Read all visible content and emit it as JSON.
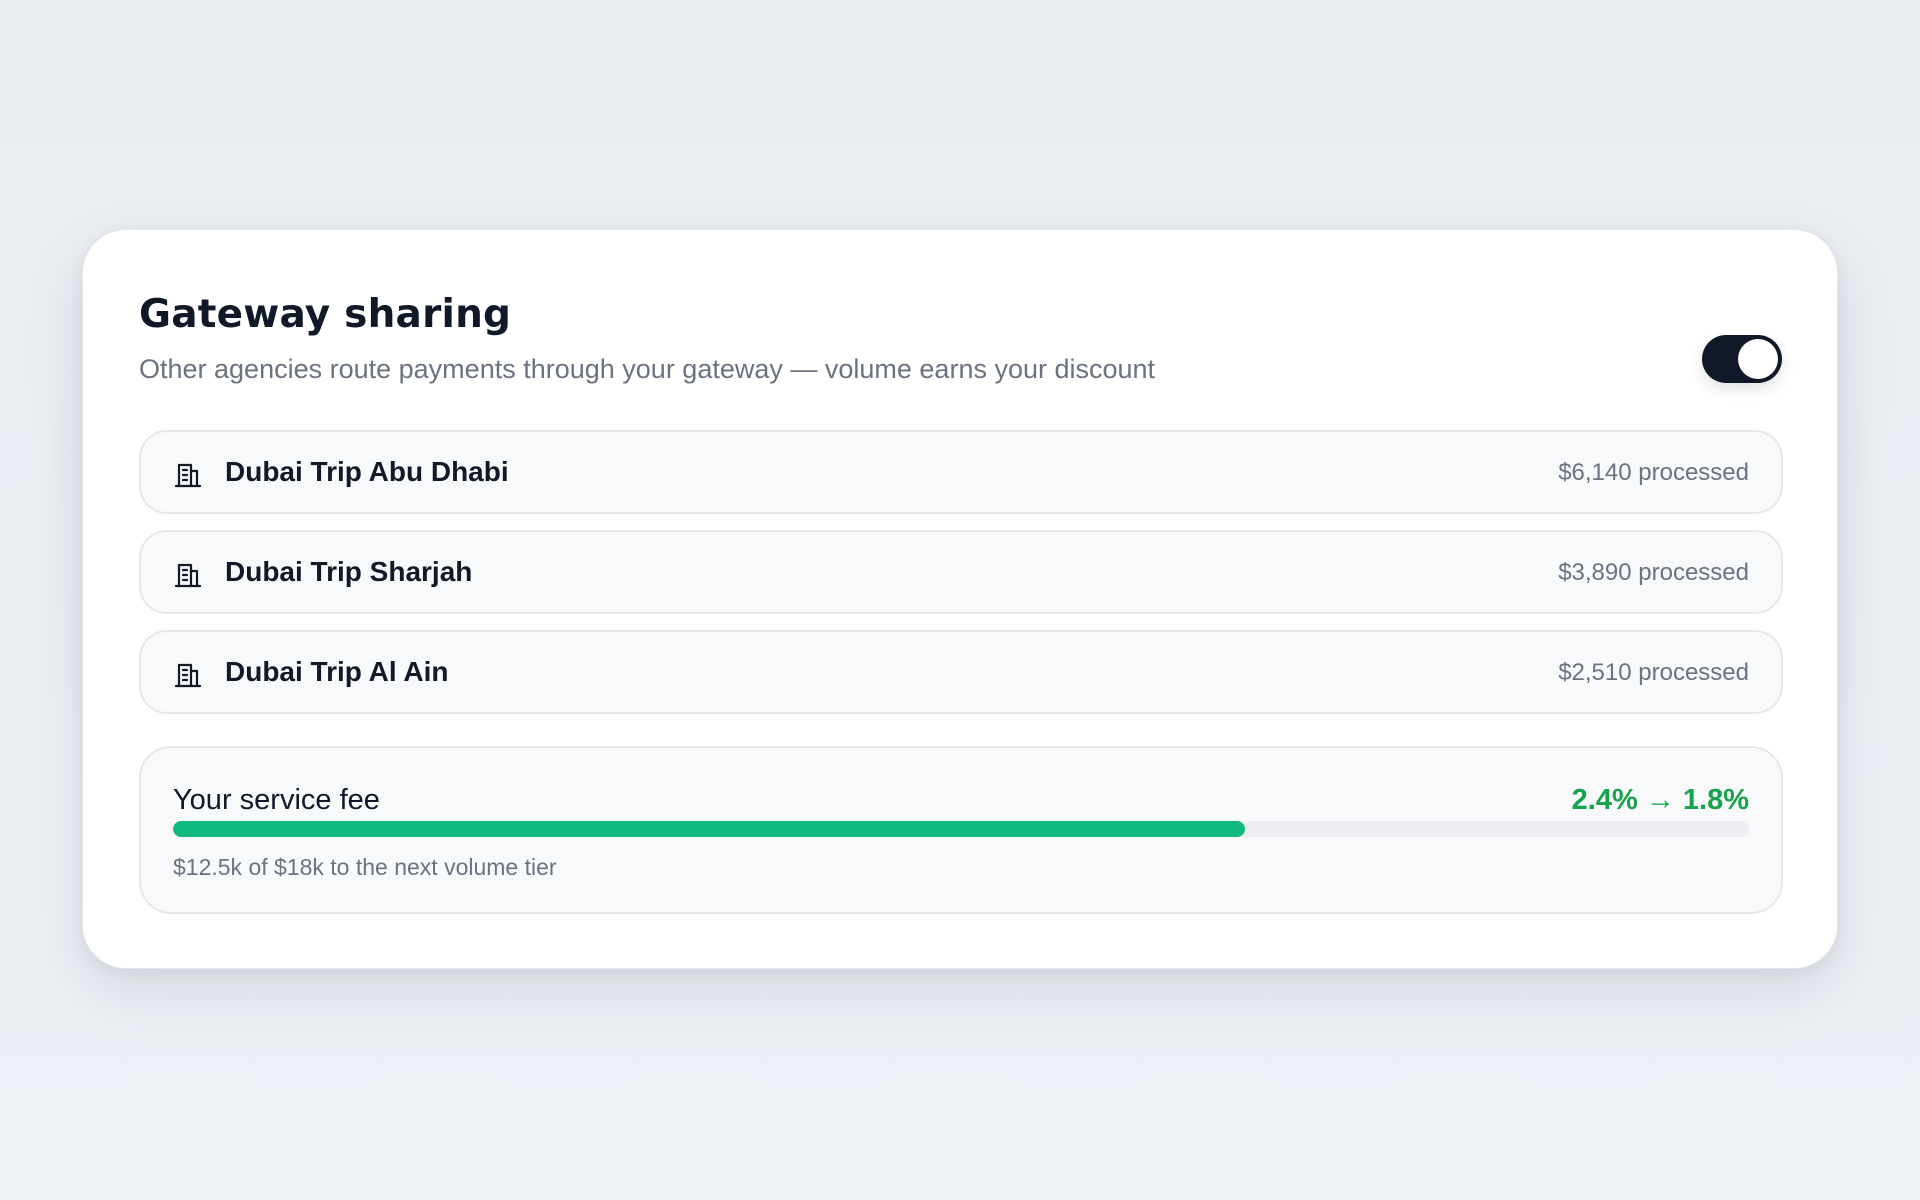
{
  "header": {
    "title": "Gateway sharing",
    "subtitle": "Other agencies route payments through your gateway — volume earns your discount"
  },
  "toggle": {
    "enabled": true
  },
  "agencies": [
    {
      "icon": "building-icon",
      "name": "Dubai Trip Abu Dhabi",
      "amount": "$6,140 processed"
    },
    {
      "icon": "building-icon",
      "name": "Dubai Trip Sharjah",
      "amount": "$3,890 processed"
    },
    {
      "icon": "building-icon",
      "name": "Dubai Trip Al Ain",
      "amount": "$2,510 processed"
    }
  ],
  "fee": {
    "label": "Your service fee",
    "change": "2.4% → 1.8%",
    "progress": 0.68,
    "note": "$12.5k of $18k to the next volume tier"
  },
  "colors": {
    "accent": "#10b981",
    "fee_text": "#16a34a",
    "toggle_on": "#111827"
  }
}
